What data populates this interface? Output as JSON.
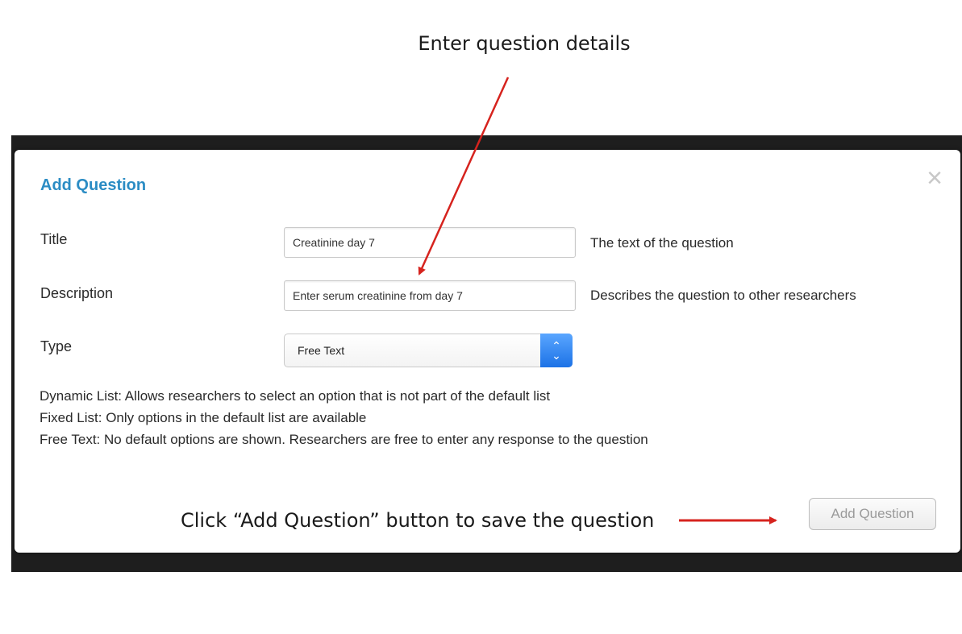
{
  "annotations": {
    "top": "Enter question details",
    "bottom": "Click “Add Question” button to save the question"
  },
  "modal": {
    "title": "Add Question",
    "close_icon": "close-icon",
    "fields": {
      "title": {
        "label": "Title",
        "value": "Creatinine day 7",
        "hint": "The text of the question"
      },
      "description": {
        "label": "Description",
        "value": "Enter serum creatinine from day 7",
        "hint": "Describes the question to other researchers"
      },
      "type": {
        "label": "Type",
        "selected": "Free Text"
      }
    },
    "help_lines": [
      "Dynamic List: Allows researchers to select an option that is not part of the default list",
      "Fixed List: Only options in the default list are available",
      "Free Text: No default options are shown. Researchers are free to enter any response to the question"
    ],
    "submit_label": "Add Question"
  },
  "colors": {
    "title_blue": "#2b8cc4",
    "arrow_red": "#d6231e",
    "stepper_blue": "#1c72e6",
    "backdrop": "#1e1e1e"
  }
}
